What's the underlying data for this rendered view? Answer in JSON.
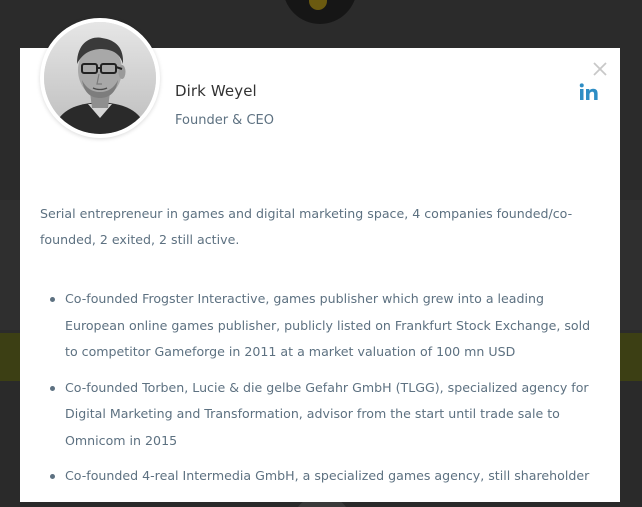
{
  "profile": {
    "name": "Dirk Weyel",
    "role": "Founder & CEO",
    "intro": "Serial entrepreneur in games and digital marketing space, 4 companies founded/co-founded, 2 exited, 2 still active.",
    "bullets": [
      "Co-founded Frogster Interactive, games publisher which grew into a leading European online games publisher, publicly listed on Frankfurt Stock Exchange, sold to competitor Gameforge in 2011 at a market valuation of 100 mn USD",
      "Co-founded Torben, Lucie & die gelbe Gefahr GmbH (TLGG), specialized agency for Digital Marketing and Transformation, advisor from the start until trade sale to Omnicom in 2015",
      "Co-founded 4-real Intermedia GmbH, a specialized games agency, still shareholder"
    ]
  },
  "icons": {
    "close": "close-icon",
    "linkedin": "linkedin-icon",
    "avatar": "portrait-photo"
  },
  "colors": {
    "linkedin": "#2e8dc4",
    "body_text": "#5d7181",
    "name_text": "#333333",
    "close": "#c8c8c8",
    "backdrop": "#2b2b2b"
  }
}
